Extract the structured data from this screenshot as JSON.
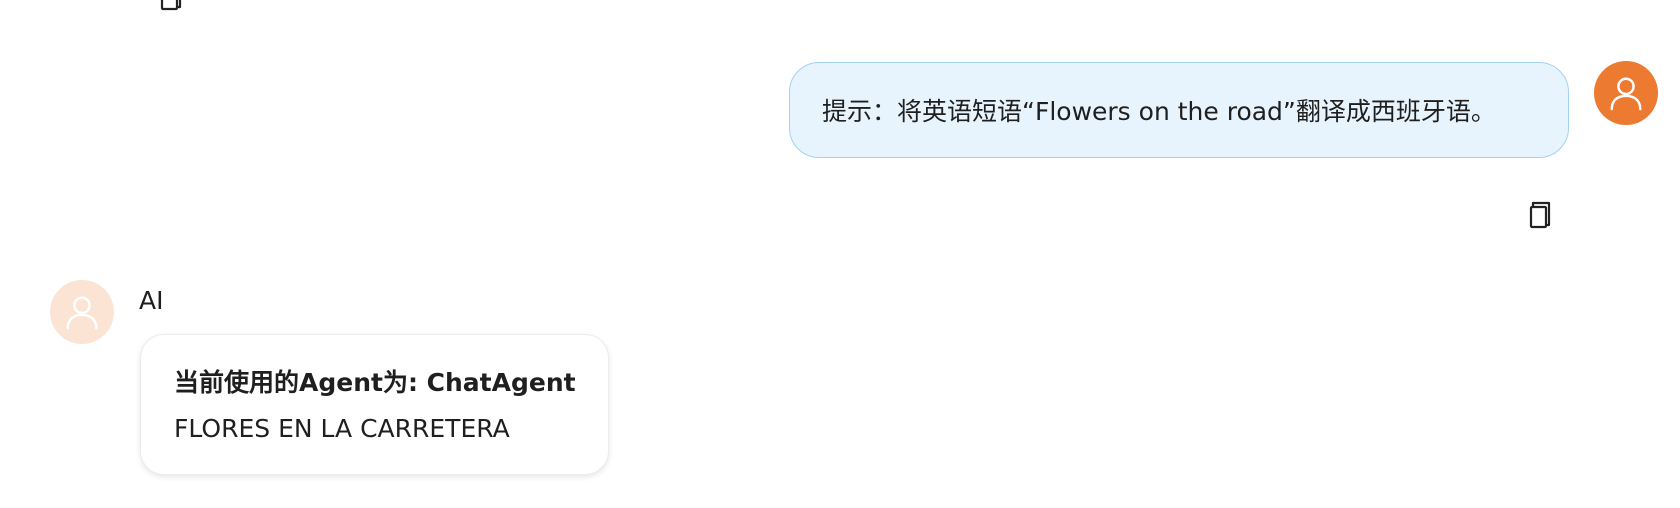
{
  "user_message": {
    "text": "提示：将英语短语“Flowers on the road”翻译成西班牙语。"
  },
  "ai_message": {
    "sender_name": "AI",
    "agent_line": "当前使用的Agent为: ChatAgent",
    "reply": "FLORES EN LA CARRETERA"
  },
  "icons": {
    "copy": "copy-icon",
    "user_avatar": "user-avatar-icon",
    "ai_avatar": "ai-avatar-icon"
  },
  "colors": {
    "user_bubble_bg": "#e8f4fd",
    "user_bubble_border": "#a3d2f2",
    "user_avatar_bg": "#ec7a31",
    "ai_avatar_bg": "#fbe4d3"
  }
}
